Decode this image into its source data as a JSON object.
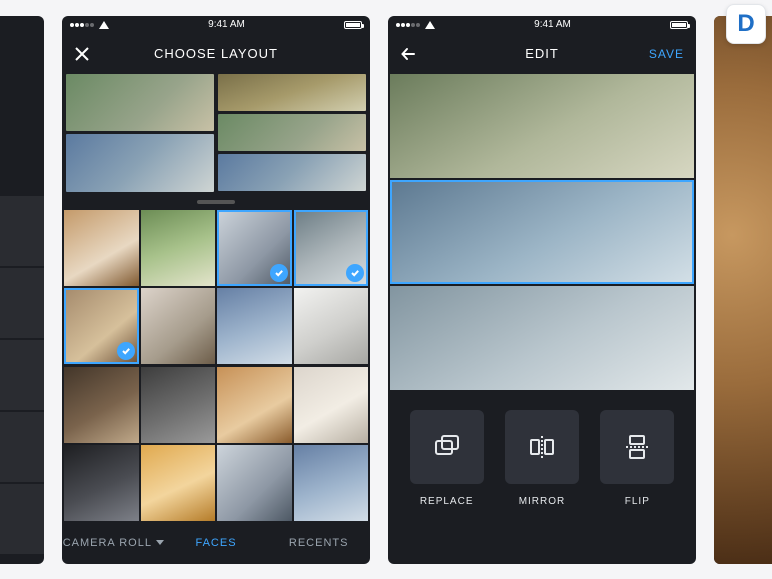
{
  "statusbar": {
    "time": "9:41 AM"
  },
  "center": {
    "title": "CHOOSE LAYOUT",
    "tabbar": {
      "camera_roll": "CAMERA ROLL",
      "faces": "FACES",
      "recents": "RECENTS"
    }
  },
  "right": {
    "title": "EDIT",
    "save": "SAVE",
    "actions": {
      "replace": "REPLACE",
      "mirror": "MIRROR",
      "flip": "FLIP"
    }
  },
  "badge": {
    "letter": "D"
  }
}
